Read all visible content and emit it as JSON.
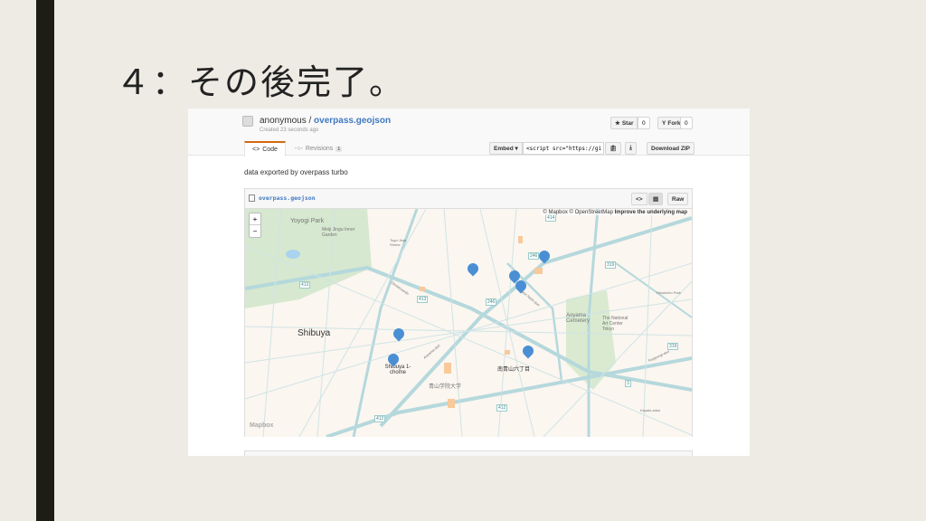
{
  "slide": {
    "title": "４：その後完了。"
  },
  "gist": {
    "owner": "anonymous",
    "separator": " / ",
    "name": "overpass.geojson",
    "created": "Created 23 seconds ago",
    "star_label": "Star",
    "star_count": "0",
    "fork_label": "Fork",
    "fork_count": "0",
    "tabs": [
      {
        "label": "Code"
      },
      {
        "label": "Revisions",
        "badge": "1"
      }
    ],
    "embed_label": "Embed ▾",
    "embed_value": "<script src=\"https://gi",
    "download_label": "Download ZIP",
    "description": "data exported by overpass turbo",
    "file": {
      "name": "overpass.geojson",
      "raw_label": "Raw"
    }
  },
  "map": {
    "zoom_in": "+",
    "zoom_out": "−",
    "attribution": "© Mapbox © OpenStreetMap",
    "improve": "Improve the underlying map",
    "logo": "Mapbox",
    "labels": [
      "Yoyogi Park",
      "Meiji Jingu Inner Garden",
      "Shibuya",
      "Aoyama Cemetery",
      "The National Art Center Tokyo",
      "Shibuya 1-chome",
      "南青山六丁目",
      "青山学院大学",
      "Togo Jinja Shrine",
      "Omotesando",
      "Aoyama-dori",
      "Gaien Nishi-dori",
      "Roppongi-dori",
      "Kayaki-zaka",
      "Hinokicho Park"
    ],
    "route_shields": [
      "413",
      "413",
      "246",
      "246",
      "414",
      "319",
      "319",
      "412",
      "412",
      "3"
    ],
    "pin_color": "#4a8fd4"
  }
}
